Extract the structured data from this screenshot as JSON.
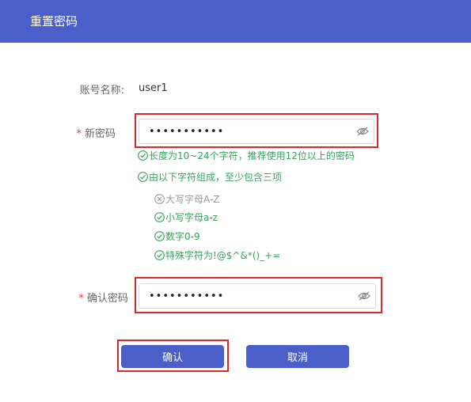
{
  "header": {
    "title": "重置密码"
  },
  "form": {
    "account_label": "账号名称:",
    "account_value": "user1",
    "new_pw_label": "新密码",
    "new_pw_value": "•••••••••••",
    "confirm_label": "确认密码",
    "confirm_value": "•••••••••••",
    "required_mark": "*"
  },
  "rules": {
    "length": "长度为10~24个字符，推荐使用12位以上的密码",
    "compose": "由以下字符组成，至少包含三项",
    "upper": "大写字母A-Z",
    "lower": "小写字母a-z",
    "digits": "数字0-9",
    "special": "特殊字符为!@$^&*()_+="
  },
  "buttons": {
    "confirm": "确认",
    "cancel": "取消"
  },
  "colors": {
    "accent": "#4a5fc9",
    "success": "#35a25b",
    "inactive": "#9a9a9a",
    "highlight": "#d9272e"
  },
  "icons": {
    "eye": "eye-off-icon",
    "ok": "check-circle-icon",
    "fail": "x-circle-icon"
  }
}
